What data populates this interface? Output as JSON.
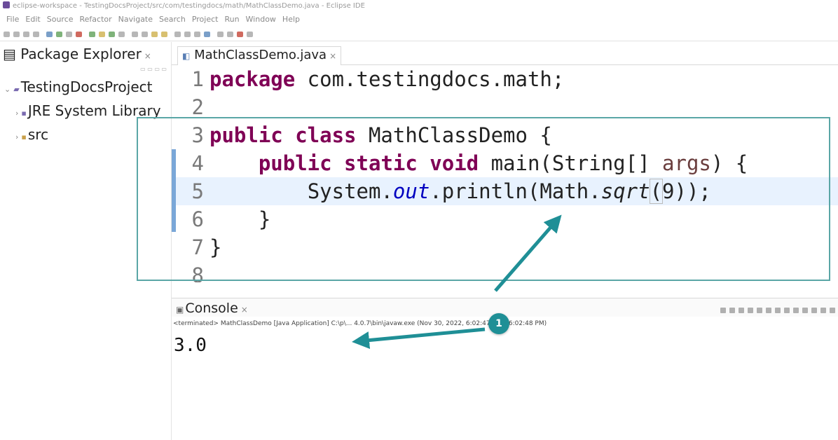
{
  "window": {
    "title": "eclipse-workspace - TestingDocsProject/src/com/testingdocs/math/MathClassDemo.java - Eclipse IDE"
  },
  "menu": [
    "File",
    "Edit",
    "Source",
    "Refactor",
    "Navigate",
    "Search",
    "Project",
    "Run",
    "Window",
    "Help"
  ],
  "explorer": {
    "tab_label": "Package Explorer",
    "tree": [
      {
        "label": "TestingDocsProject"
      },
      {
        "label": "JRE System Library"
      },
      {
        "label": "src"
      }
    ]
  },
  "editor": {
    "tab_label": "MathClassDemo.java",
    "lines": [
      {
        "n": "1"
      },
      {
        "n": "2"
      },
      {
        "n": "3"
      },
      {
        "n": "4"
      },
      {
        "n": "5"
      },
      {
        "n": "6"
      },
      {
        "n": "7"
      },
      {
        "n": "8"
      }
    ],
    "code": {
      "l1_kw": "package",
      "l1_rest": " com.testingdocs.math;",
      "l3_kw": "public class",
      "l3_rest": " MathClassDemo {",
      "l4_kw": "public static void",
      "l4_a": " main(String[] ",
      "l4_args": "args",
      "l4_b": ") {",
      "l5_a": "System.",
      "l5_field": "out",
      "l5_b": ".println(Math.",
      "l5_method": "sqrt",
      "l5_c": "(",
      "l5_d": "9));",
      "l6": "}",
      "l7": "}"
    }
  },
  "console": {
    "tab_label": "Console",
    "status": "<terminated> MathClassDemo [Java Application] C:\\p\\... 4.0.7\\bin\\javaw.exe (Nov 30, 2022, 6:02:47 PM – 6:02:48 PM)",
    "output": "3.0"
  },
  "annotation": {
    "callout_number": "1",
    "color": "#1f8f96"
  }
}
